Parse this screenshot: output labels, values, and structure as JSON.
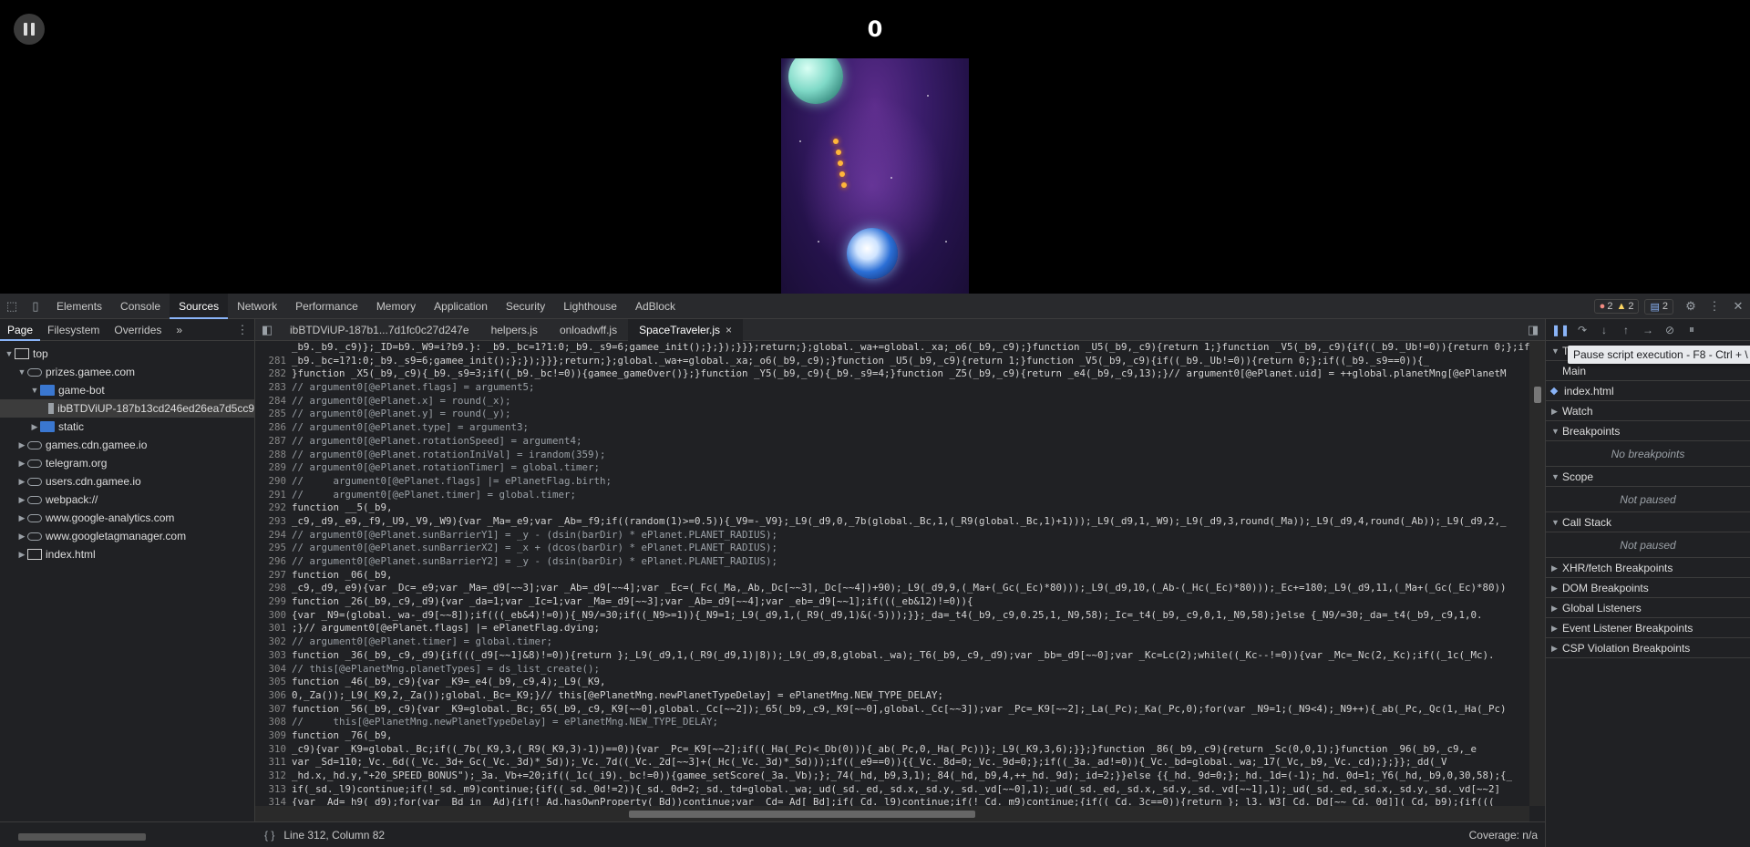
{
  "game": {
    "score": "0"
  },
  "devtools": {
    "main_tabs": [
      "Elements",
      "Console",
      "Sources",
      "Network",
      "Performance",
      "Memory",
      "Application",
      "Security",
      "Lighthouse",
      "AdBlock"
    ],
    "active_tab": "Sources",
    "errors": "2",
    "warnings": "2",
    "messages": "2",
    "navigator": {
      "tabs": [
        "Page",
        "Filesystem",
        "Overrides"
      ],
      "more": "»",
      "tree": [
        {
          "label": "top",
          "depth": 0,
          "icon": "frame",
          "arrow": "▼"
        },
        {
          "label": "prizes.gamee.com",
          "depth": 1,
          "icon": "cloud",
          "arrow": "▼"
        },
        {
          "label": "game-bot",
          "depth": 2,
          "icon": "folder",
          "arrow": "▼"
        },
        {
          "label": "ibBTDViUP-187b13cd246ed26ea7d5cc9",
          "depth": 3,
          "icon": "file",
          "arrow": "",
          "selected": true
        },
        {
          "label": "static",
          "depth": 2,
          "icon": "folder",
          "arrow": "▶"
        },
        {
          "label": "games.cdn.gamee.io",
          "depth": 1,
          "icon": "cloud",
          "arrow": "▶"
        },
        {
          "label": "telegram.org",
          "depth": 1,
          "icon": "cloud",
          "arrow": "▶"
        },
        {
          "label": "users.cdn.gamee.io",
          "depth": 1,
          "icon": "cloud",
          "arrow": "▶"
        },
        {
          "label": "webpack://",
          "depth": 1,
          "icon": "cloud",
          "arrow": "▶"
        },
        {
          "label": "www.google-analytics.com",
          "depth": 1,
          "icon": "cloud",
          "arrow": "▶"
        },
        {
          "label": "www.googletagmanager.com",
          "depth": 1,
          "icon": "cloud",
          "arrow": "▶"
        },
        {
          "label": "index.html",
          "depth": 1,
          "icon": "frame",
          "arrow": "▶"
        }
      ]
    },
    "editor": {
      "tabs": [
        {
          "label": "ibBTDViUP-187b1...7d1fc0c27d247e",
          "active": false
        },
        {
          "label": "helpers.js",
          "active": false
        },
        {
          "label": "onloadwff.js",
          "active": false
        },
        {
          "label": "SpaceTraveler.js",
          "active": true
        }
      ],
      "close_glyph": "×",
      "lines": [
        {
          "n": "",
          "t": "_b9._b9._c9)};_ID=b9._W9=i?b9.}: _b9._bc=1?1:0;_b9._s9=6;gamee_init();};});}}};return;};global._wa+=global._xa;_o6(_b9,_c9);}function _U5(_b9,_c9){return 1;}function _V5(_b9,_c9){if((_b9._Ub!=0)){return 0;};if((_b9._s9==0)){_"
        },
        {
          "n": "281",
          "t": "_b9._bc=1?1:0;_b9._s9=6;gamee_init();};});}}};return;};global._wa+=global._xa;_o6(_b9,_c9);}function _U5(_b9,_c9){return 1;}function _V5(_b9,_c9){if((_b9._Ub!=0)){return 0;};if((_b9._s9==0)){_"
        },
        {
          "n": "282",
          "t": "}function _X5(_b9,_c9){_b9._s9=3;if((_b9._bc!=0)){gamee_gameOver()};}function _Y5(_b9,_c9){_b9._s9=4;}function _Z5(_b9,_c9){return _e4(_b9,_c9,13);}// argument0[@ePlanet.uid] = ++global.planetMng[@ePlanetM"
        },
        {
          "n": "283",
          "t": "// argument0[@ePlanet.flags] = argument5;",
          "c": true
        },
        {
          "n": "284",
          "t": "// argument0[@ePlanet.x] = round(_x);",
          "c": true
        },
        {
          "n": "285",
          "t": "// argument0[@ePlanet.y] = round(_y);",
          "c": true
        },
        {
          "n": "286",
          "t": "// argument0[@ePlanet.type] = argument3;",
          "c": true
        },
        {
          "n": "287",
          "t": "// argument0[@ePlanet.rotationSpeed] = argument4;",
          "c": true
        },
        {
          "n": "288",
          "t": "// argument0[@ePlanet.rotationIniVal] = irandom(359);",
          "c": true
        },
        {
          "n": "289",
          "t": "// argument0[@ePlanet.rotationTimer] = global.timer;",
          "c": true
        },
        {
          "n": "290",
          "t": "//     argument0[@ePlanet.flags] |= ePlanetFlag.birth;",
          "c": true
        },
        {
          "n": "291",
          "t": "//     argument0[@ePlanet.timer] = global.timer;",
          "c": true
        },
        {
          "n": "292",
          "t": "function __5(_b9,"
        },
        {
          "n": "293",
          "t": "_c9,_d9,_e9,_f9,_U9,_V9,_W9){var _Ma=_e9;var _Ab=_f9;if((random(1)>=0.5)){_V9=-_V9};_L9(_d9,0,_7b(global._Bc,1,(_R9(global._Bc,1)+1)));_L9(_d9,1,_W9);_L9(_d9,3,round(_Ma));_L9(_d9,4,round(_Ab));_L9(_d9,2,_"
        },
        {
          "n": "294",
          "t": "// argument0[@ePlanet.sunBarrierY1] = _y - (dsin(barDir) * ePlanet.PLANET_RADIUS);",
          "c": true
        },
        {
          "n": "295",
          "t": "// argument0[@ePlanet.sunBarrierX2] = _x + (dcos(barDir) * ePlanet.PLANET_RADIUS);",
          "c": true
        },
        {
          "n": "296",
          "t": "// argument0[@ePlanet.sunBarrierY2] = _y - (dsin(barDir) * ePlanet.PLANET_RADIUS);",
          "c": true
        },
        {
          "n": "297",
          "t": "function _06(_b9,"
        },
        {
          "n": "298",
          "t": "_c9,_d9,_e9){var _Dc=_e9;var _Ma=_d9[~~3];var _Ab=_d9[~~4];var _Ec=(_Fc(_Ma,_Ab,_Dc[~~3],_Dc[~~4])+90);_L9(_d9,9,(_Ma+(_Gc(_Ec)*80)));_L9(_d9,10,(_Ab-(_Hc(_Ec)*80)));_Ec+=180;_L9(_d9,11,(_Ma+(_Gc(_Ec)*80))"
        },
        {
          "n": "299",
          "t": "function _26(_b9,_c9,_d9){var _da=1;var _Ic=1;var _Ma=_d9[~~3];var _Ab=_d9[~~4];var _eb=_d9[~~1];if(((_eb&12)!=0)){"
        },
        {
          "n": "300",
          "t": "{var _N9=(global._wa-_d9[~~8]);if(((_eb&4)!=0)){_N9/=30;if((_N9>=1)){_N9=1;_L9(_d9,1,(_R9(_d9,1)&(-5)));}};_da=_t4(_b9,_c9,0.25,1,_N9,58);_Ic=_t4(_b9,_c9,0,1,_N9,58);}else {_N9/=30;_da=_t4(_b9,_c9,1,0."
        },
        {
          "n": "301",
          "t": ";}// argument0[@ePlanet.flags] |= ePlanetFlag.dying;"
        },
        {
          "n": "302",
          "t": "// argument0[@ePlanet.timer] = global.timer;",
          "c": true
        },
        {
          "n": "303",
          "t": "function _36(_b9,_c9,_d9){if(((_d9[~~1]&8)!=0)){return };_L9(_d9,1,(_R9(_d9,1)|8));_L9(_d9,8,global._wa);_T6(_b9,_c9,_d9);var _bb=_d9[~~0];var _Kc=Lc(2);while((_Kc--!=0)){var _Mc=_Nc(2,_Kc);if((_1c(_Mc)."
        },
        {
          "n": "304",
          "t": "// this[@ePlanetMng.planetTypes] = ds_list_create();",
          "c": true
        },
        {
          "n": "305",
          "t": "function _46(_b9,_c9){var _K9=_e4(_b9,_c9,4);_L9(_K9,"
        },
        {
          "n": "306",
          "t": "0,_Za());_L9(_K9,2,_Za());global._Bc=_K9;}// this[@ePlanetMng.newPlanetTypeDelay] = ePlanetMng.NEW_TYPE_DELAY;"
        },
        {
          "n": "307",
          "t": "function _56(_b9,_c9){var _K9=global._Bc;_65(_b9,_c9,_K9[~~0],global._Cc[~~2]);_65(_b9,_c9,_K9[~~0],global._Cc[~~3]);var _Pc=_K9[~~2];_La(_Pc);_Ka(_Pc,0);for(var _N9=1;(_N9<4);_N9++){_ab(_Pc,_Qc(1,_Ha(_Pc)"
        },
        {
          "n": "308",
          "t": "//     this[@ePlanetMng.newPlanetTypeDelay] = ePlanetMng.NEW_TYPE_DELAY;",
          "c": true
        },
        {
          "n": "309",
          "t": "function _76(_b9,"
        },
        {
          "n": "310",
          "t": "_c9){var _K9=global._Bc;if((_7b(_K9,3,(_R9(_K9,3)-1))==0)){var _Pc=_K9[~~2];if((_Ha(_Pc)<_Db(0))){_ab(_Pc,0,_Ha(_Pc))};_L9(_K9,3,6);}};}function _86(_b9,_c9){return _Sc(0,0,1);}function _96(_b9,_c9,_e"
        },
        {
          "n": "311",
          "t": "var _Sd=110;_Vc._6d((_Vc._3d+_Gc(_Vc._3d)*_Sd));_Vc._7d((_Vc._2d[~~3]+(_Hc(_Vc._3d)*_Sd)));if((_e9==0)){{_Vc._8d=0;_Vc._9d=0;};if((_3a._ad!=0)){_Vc._bd=global._wa;_17(_Vc,_b9,_Vc._cd);};}};_dd(_V"
        },
        {
          "n": "312",
          "t": "_hd.x,_hd.y,\"+20_SPEED_BONUS\");_3a._Vb+=20;if((_1c(_i9)._bc!=0)){gamee_setScore(_3a._Vb);};_74(_hd,_b9,3,1);_84(_hd,_b9,4,++_hd._9d);_id=2;}}else {{_hd._9d=0;};_hd._1d=(-1);_hd._0d=1;_Y6(_hd,_b9,0,30,58);{_"
        },
        {
          "n": "313",
          "t": "if(_sd._l9)continue;if(!_sd._m9)continue;{if((_sd._0d!=2)){_sd._0d=2;_sd._td=global._wa;_ud(_sd._ed,_sd.x,_sd.y,_sd._vd[~~0],1);_ud(_sd._ed,_sd.x,_sd.y,_sd._vd[~~1],1);_ud(_sd._ed,_sd.x,_sd.y,_sd._vd[~~2]"
        },
        {
          "n": "314",
          "t": "{var _Ad=_h9(_d9);for(var _Bd in _Ad){if(!_Ad.hasOwnProperty(_Bd))continue;var _Cd=_Ad[_Bd];if(_Cd._l9)continue;if(!_Cd._m9)continue;{if((_Cd._3c==0)){return };_l3._W3[_Cd._Dd[~~_Cd._0d]](_Cd,_b9);{if((("
        },
        {
          "n": "315",
          "t": "_b9._Xc=_b9._Yc;}};}};var _Ed=(_b9._Xc*global._xa);var _Fd=_b9._3d;var _Gd=((_Fd+_Ed)%360);if((_Gd<0)){_Gd+=360};_b9._3d=_Gd;_b9._4d(_Gd);_b9._Zc+=abs(_Ed);_N9=floor((_b9._Zc/360));if((_N9!=_b9.__c)){_b9"
        }
      ]
    },
    "status": {
      "format_glyph": "{ }",
      "position": "Line 312, Column 82",
      "coverage": "Coverage: n/a"
    },
    "debugger": {
      "tooltip": "Pause script execution - F8 - Ctrl + \\",
      "threads_label": "T",
      "main": "Main",
      "thread_index": "index.html",
      "sections": {
        "watch": "Watch",
        "breakpoints": "Breakpoints",
        "no_breakpoints": "No breakpoints",
        "scope": "Scope",
        "not_paused_scope": "Not paused",
        "callstack": "Call Stack",
        "not_paused_callstack": "Not paused",
        "xhr": "XHR/fetch Breakpoints",
        "dom": "DOM Breakpoints",
        "global": "Global Listeners",
        "event": "Event Listener Breakpoints",
        "csp": "CSP Violation Breakpoints"
      }
    }
  }
}
